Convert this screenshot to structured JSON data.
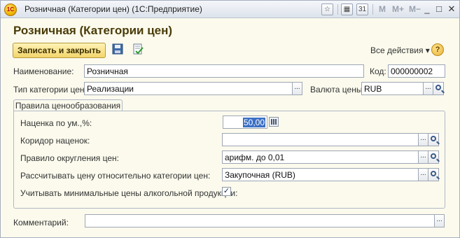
{
  "window": {
    "title": "Розничная (Категории цен)  (1С:Предприятие)",
    "logo_text": "1С"
  },
  "titlebar": {
    "m_label": "M",
    "m_plus_label": "M+",
    "m_minus_label": "M−",
    "minimize_glyph": "_",
    "restore_glyph": "□",
    "close_glyph": "✕"
  },
  "form": {
    "title": "Розничная (Категории цен)",
    "save_close_label": "Записать и закрыть",
    "all_actions_label": "Все действия ▾",
    "help_label": "?"
  },
  "fields": {
    "name_label": "Наименование:",
    "name_value": "Розничная",
    "code_label": "Код:",
    "code_value": "000000002",
    "category_type_label": "Тип категории цен:",
    "category_type_value": "Реализации",
    "currency_label": "Валюта цены:",
    "currency_value": "RUB"
  },
  "pricing_group": {
    "title": "Правила ценообразования",
    "markup_label": "Наценка по ум.,%:",
    "markup_value": "50,00",
    "corridor_label": "Коридор наценок:",
    "corridor_value": "",
    "rounding_label": "Правило округления цен:",
    "rounding_value": "арифм. до 0,01",
    "base_category_label": "Рассчитывать цену относительно категории цен:",
    "base_category_value": "Закупочная (RUB)",
    "alcohol_min_label": "Учитывать минимальные цены алкогольной продукции:",
    "alcohol_min_checked": true,
    "checkmark": "✓"
  },
  "comment": {
    "label": "Комментарий:",
    "value": ""
  },
  "buttons": {
    "select_glyph": "..."
  }
}
